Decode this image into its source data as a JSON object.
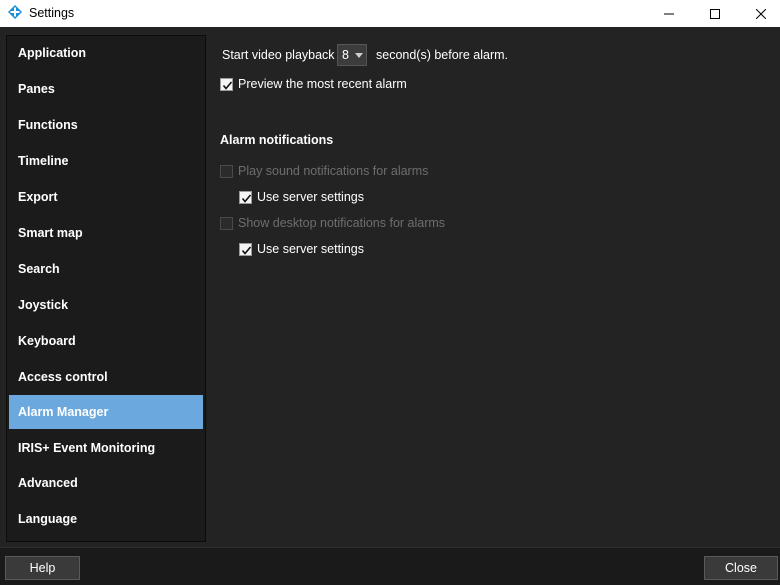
{
  "window": {
    "title": "Settings"
  },
  "sidebar": {
    "items": [
      {
        "label": "Application"
      },
      {
        "label": "Panes"
      },
      {
        "label": "Functions"
      },
      {
        "label": "Timeline"
      },
      {
        "label": "Export"
      },
      {
        "label": "Smart map"
      },
      {
        "label": "Search"
      },
      {
        "label": "Joystick"
      },
      {
        "label": "Keyboard"
      },
      {
        "label": "Access control"
      },
      {
        "label": "Alarm Manager",
        "selected": true
      },
      {
        "label": "IRIS+ Event Monitoring"
      },
      {
        "label": "Advanced"
      },
      {
        "label": "Language"
      }
    ]
  },
  "main": {
    "playback_prefix": "Start video playback",
    "playback_value": "8",
    "playback_suffix": "second(s) before alarm.",
    "preview_label": "Preview the most recent alarm",
    "preview_checked": true,
    "notifications_heading": "Alarm notifications",
    "play_sound_label": "Play sound notifications for alarms",
    "play_sound_checked": false,
    "play_sound_server_label": "Use server settings",
    "play_sound_server_checked": true,
    "desktop_label": "Show desktop notifications for alarms",
    "desktop_checked": false,
    "desktop_server_label": "Use server settings",
    "desktop_server_checked": true
  },
  "footer": {
    "help_label": "Help",
    "close_label": "Close"
  },
  "colors": {
    "accent": "#6aa8de",
    "background": "#232323",
    "sidebar": "#1b1b1b"
  }
}
